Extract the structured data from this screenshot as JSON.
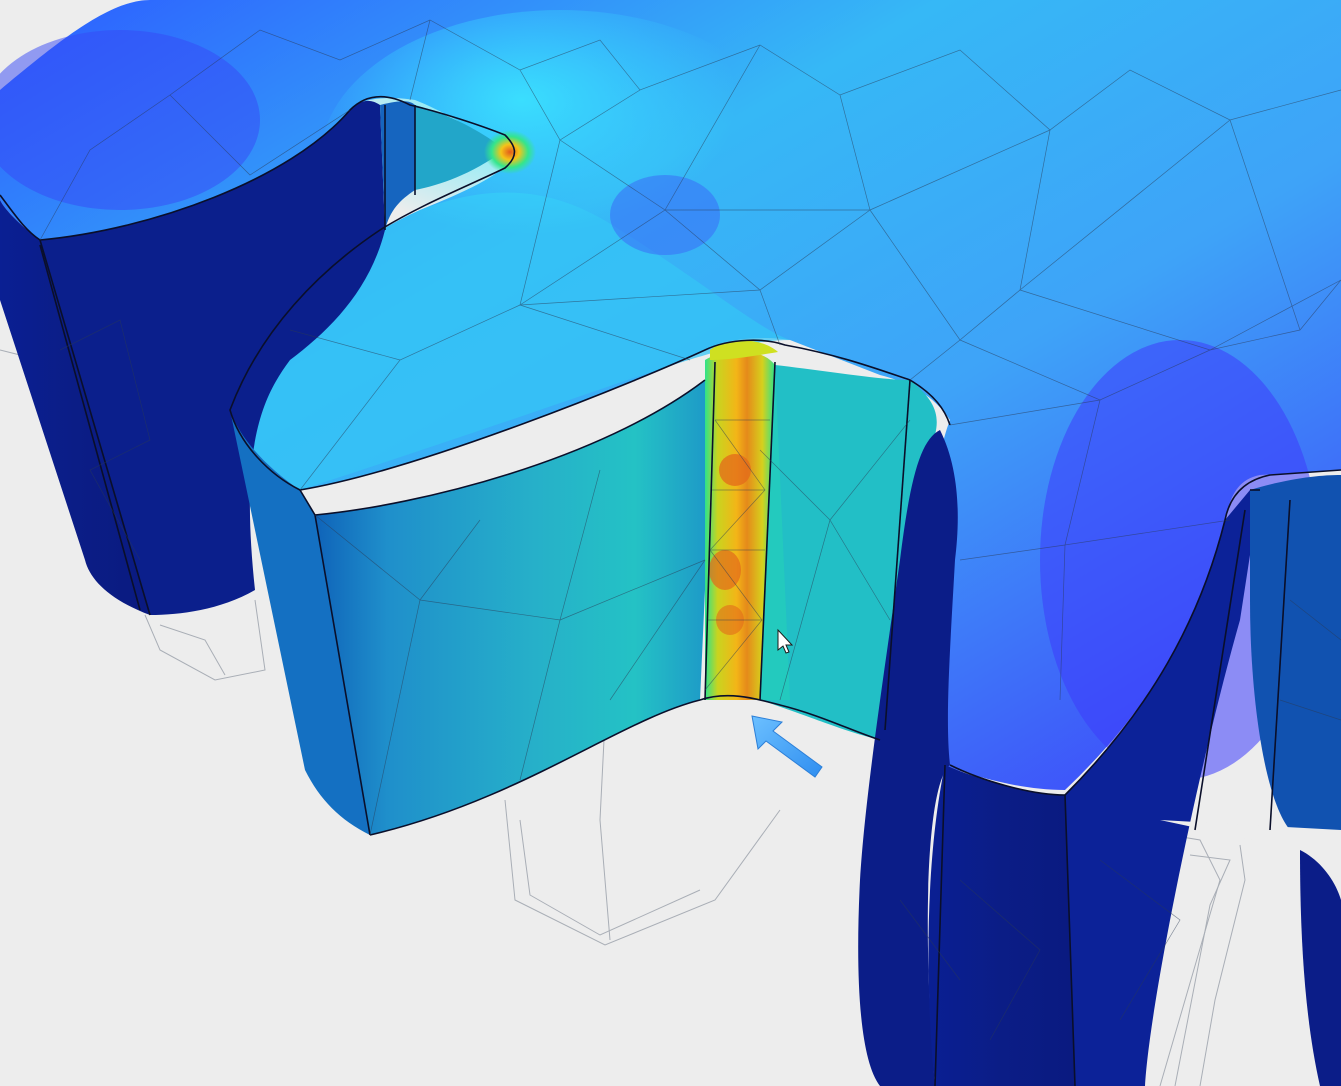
{
  "viewport": {
    "background": "#ededed"
  },
  "colors": {
    "surface_low": "#3d4dff",
    "surface_mid": "#38c8f4",
    "stress_medium": "#2ee38a",
    "stress_high": "#f6b516",
    "stress_peak": "#e2571c",
    "shadow_deep": "#081a8a",
    "arrow": "#3fa0f5",
    "mesh_line": "#2a3a55",
    "ghost_line": "#aab0b8"
  },
  "load_arrow": {
    "icon": "force-arrow-icon"
  },
  "cursor": {
    "icon": "mouse-pointer-icon"
  }
}
